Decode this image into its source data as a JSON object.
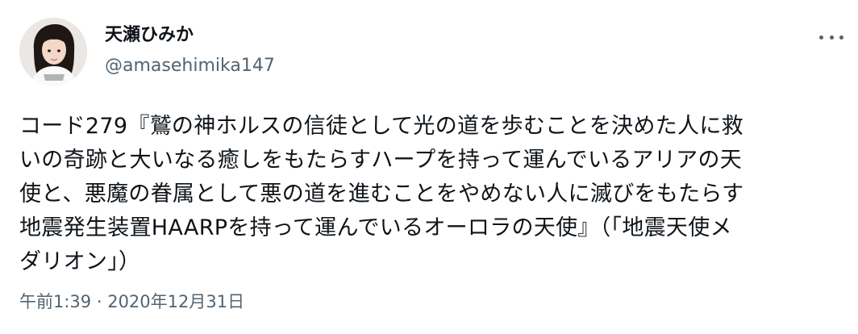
{
  "author": {
    "display_name": "天瀬ひみか",
    "handle": "@amasehimika147"
  },
  "icons": {
    "more": "more-horizontal-icon",
    "avatar": "profile-photo"
  },
  "tweet": {
    "lines": [
      "コード279『鷲の神ホルスの信徒として光の道を歩むことを決めた人に救",
      "いの奇跡と大いなる癒しをもたらすハープを持って運んでいるアリアの天",
      "使と、悪魔の眷属として悪の道を進むことをやめない人に滅びをもたらす",
      "地震発生装置HAARPを持って運んでいるオーロラの天使』（「地震天使メ",
      "ダリオン」）"
    ]
  },
  "meta": {
    "time": "午前1:39",
    "separator": " · ",
    "date": "2020年12月31日"
  },
  "colors": {
    "text": "#0f1419",
    "secondary": "#536471",
    "background": "#ffffff"
  }
}
